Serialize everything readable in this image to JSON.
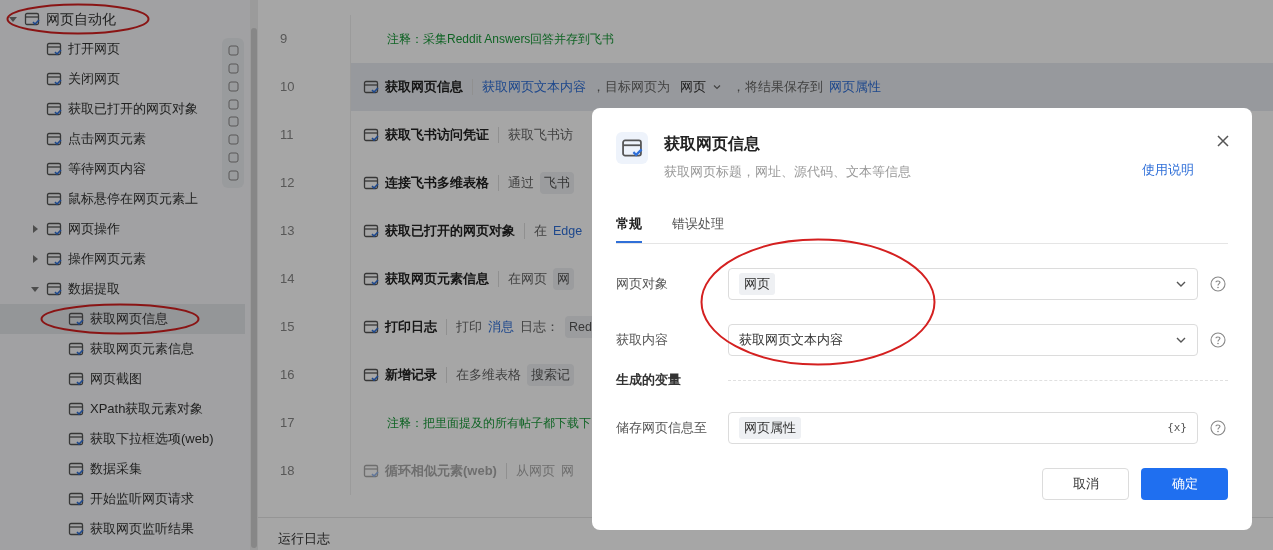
{
  "sidebar": {
    "tree": [
      {
        "label": "网页自动化",
        "expanded": true,
        "selected": false,
        "circled": true,
        "children": [
          {
            "label": "打开网页",
            "selected": false,
            "circled": false
          },
          {
            "label": "关闭网页",
            "selected": false,
            "circled": false
          },
          {
            "label": "获取已打开的网页对象",
            "selected": false,
            "circled": false
          },
          {
            "label": "点击网页元素",
            "selected": false,
            "circled": false
          },
          {
            "label": "等待网页内容",
            "selected": false,
            "circled": false
          },
          {
            "label": "鼠标悬停在网页元素上",
            "selected": false,
            "circled": false
          },
          {
            "label": "网页操作",
            "expanded": false,
            "selected": false,
            "circled": false
          },
          {
            "label": "操作网页元素",
            "expanded": false,
            "selected": false,
            "circled": false
          },
          {
            "label": "数据提取",
            "expanded": true,
            "selected": false,
            "circled": false,
            "children": [
              {
                "label": "获取网页信息",
                "selected": true,
                "circled": true
              },
              {
                "label": "获取网页元素信息",
                "selected": false,
                "circled": false
              },
              {
                "label": "网页截图",
                "selected": false,
                "circled": false
              },
              {
                "label": "XPath获取元素对象",
                "selected": false,
                "circled": false
              },
              {
                "label": "获取下拉框选项(web)",
                "selected": false,
                "circled": false
              },
              {
                "label": "数据采集",
                "selected": false,
                "circled": false
              },
              {
                "label": "开始监听网页请求",
                "selected": false,
                "circled": false
              },
              {
                "label": "获取网页监听结果",
                "selected": false,
                "circled": false
              }
            ]
          }
        ]
      }
    ]
  },
  "steps": [
    {
      "number": "9",
      "kind": "comment",
      "selected": false,
      "text": "注释：采集Reddit Answers回答并存到飞书"
    },
    {
      "number": "10",
      "kind": "action",
      "selected": true,
      "disabled": false,
      "title": "获取网页信息",
      "parts": [
        {
          "kind": "link",
          "text": "获取网页文本内容"
        },
        {
          "kind": "text",
          "text": "，目标网页为"
        },
        {
          "kind": "dropdown",
          "text": "网页"
        },
        {
          "kind": "text",
          "text": "，将结果保存到"
        },
        {
          "kind": "link",
          "text": "网页属性"
        }
      ]
    },
    {
      "number": "11",
      "kind": "action",
      "selected": false,
      "disabled": false,
      "title": "获取飞书访问凭证",
      "parts": [
        {
          "kind": "text",
          "text": "获取飞书访"
        }
      ]
    },
    {
      "number": "12",
      "kind": "action",
      "selected": false,
      "disabled": false,
      "title": "连接飞书多维表格",
      "parts": [
        {
          "kind": "text",
          "text": "通过"
        },
        {
          "kind": "chip",
          "text": "飞书"
        }
      ]
    },
    {
      "number": "13",
      "kind": "action",
      "selected": false,
      "disabled": false,
      "title": "获取已打开的网页对象",
      "parts": [
        {
          "kind": "text",
          "text": "在"
        },
        {
          "kind": "link",
          "text": "Edge"
        }
      ]
    },
    {
      "number": "14",
      "kind": "action",
      "selected": false,
      "disabled": false,
      "title": "获取网页元素信息",
      "parts": [
        {
          "kind": "text",
          "text": "在网页"
        },
        {
          "kind": "chip",
          "text": "网"
        }
      ]
    },
    {
      "number": "15",
      "kind": "action",
      "selected": false,
      "disabled": false,
      "title": "打印日志",
      "parts": [
        {
          "kind": "text",
          "text": "打印"
        },
        {
          "kind": "link",
          "text": "消息"
        },
        {
          "kind": "text",
          "text": "日志："
        },
        {
          "kind": "chip",
          "text": "Red"
        }
      ]
    },
    {
      "number": "16",
      "kind": "action",
      "selected": false,
      "disabled": false,
      "title": "新增记录",
      "parts": [
        {
          "kind": "text",
          "text": "在多维表格"
        },
        {
          "kind": "chip",
          "text": "搜索记"
        }
      ]
    },
    {
      "number": "17",
      "kind": "comment",
      "selected": false,
      "text": "注释：把里面提及的所有帖子都下载下"
    },
    {
      "number": "18",
      "kind": "action",
      "selected": false,
      "disabled": true,
      "title": "循环相似元素(web)",
      "parts": [
        {
          "kind": "text",
          "text": "从网页"
        },
        {
          "kind": "text",
          "text": "网"
        }
      ]
    }
  ],
  "log_panel": {
    "title": "运行日志"
  },
  "dialog": {
    "title": "获取网页信息",
    "subtitle": "获取网页标题，网址、源代码、文本等信息",
    "help_link": "使用说明",
    "tabs": [
      {
        "label": "常规",
        "selected": true
      },
      {
        "label": "错误处理",
        "selected": false
      }
    ],
    "fields": {
      "circled": true,
      "items": [
        {
          "label": "网页对象",
          "kind": "select",
          "value": "网页",
          "chip": true
        },
        {
          "label": "获取内容",
          "kind": "select",
          "value": "获取网页文本内容",
          "chip": false
        }
      ]
    },
    "section_title": "生成的变量",
    "outputs": [
      {
        "label": "储存网页信息至",
        "kind": "variable",
        "value": "网页属性",
        "var_icon": "{x}"
      }
    ],
    "buttons": [
      {
        "label": "取消",
        "primary": false
      },
      {
        "label": "确定",
        "primary": true
      }
    ]
  }
}
